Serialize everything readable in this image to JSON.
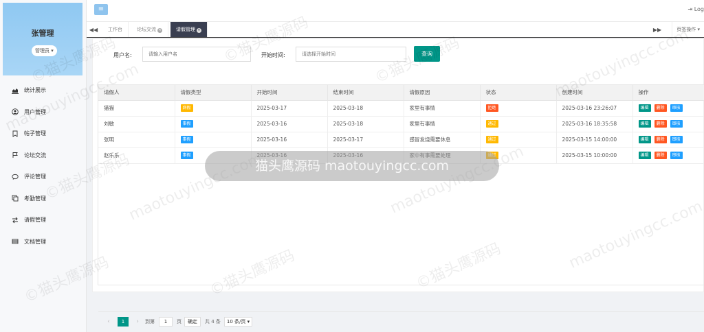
{
  "profile": {
    "name": "张管理",
    "role": "管理员 ▾"
  },
  "nav": [
    {
      "label": "统计展示",
      "icon": "chart-icon"
    },
    {
      "label": "用户管理",
      "icon": "user-icon"
    },
    {
      "label": "帖子管理",
      "icon": "bookmark-icon"
    },
    {
      "label": "论坛交流",
      "icon": "flag-icon"
    },
    {
      "label": "评论管理",
      "icon": "comment-icon"
    },
    {
      "label": "考勤管理",
      "icon": "copy-icon"
    },
    {
      "label": "请假管理",
      "icon": "exchange-icon"
    },
    {
      "label": "文档管理",
      "icon": "list-icon"
    }
  ],
  "topbar": {
    "menu_icon": "≡",
    "logout": "⇥  Log"
  },
  "tabs": {
    "prev": "◀◀",
    "next": "▶▶",
    "items": [
      {
        "label": "工作台"
      },
      {
        "label": "论坛交流"
      },
      {
        "label": "请假管理"
      }
    ],
    "page_ops": "页签操作 ▾"
  },
  "search": {
    "username_label": "用户名:",
    "username_placeholder": "请输入用户名",
    "start_label": "开始时间:",
    "start_placeholder": "请选择开始时间",
    "query_button": "查询"
  },
  "table": {
    "headers": [
      "请假人",
      "请假类型",
      "开始时间",
      "结束时间",
      "请假原因",
      "状态",
      "创建时间",
      "操作"
    ],
    "rows": [
      {
        "name": "猫猫",
        "type": "病假",
        "type_color": "orange",
        "start": "2025-03-17",
        "end": "2025-03-18",
        "reason": "家里有事情",
        "status": "拒绝",
        "status_color": "red",
        "created": "2025-03-16 23:26:07"
      },
      {
        "name": "刘敏",
        "type": "事假",
        "type_color": "blue",
        "start": "2025-03-16",
        "end": "2025-03-18",
        "reason": "家里有事情",
        "status": "通过",
        "status_color": "gold",
        "created": "2025-03-16 18:35:58"
      },
      {
        "name": "张明",
        "type": "事假",
        "type_color": "blue",
        "start": "2025-03-16",
        "end": "2025-03-17",
        "reason": "感冒发烧需要休息",
        "status": "通过",
        "status_color": "gold",
        "created": "2025-03-15 14:00:00"
      },
      {
        "name": "赵乐乐",
        "type": "事假",
        "type_color": "blue",
        "start": "2025-03-16",
        "end": "2025-03-16",
        "reason": "家中有事需要处理",
        "status": "通过",
        "status_color": "gold",
        "created": "2025-03-15 10:00:00"
      }
    ],
    "actions": {
      "edit": "编辑",
      "delete": "删除",
      "audit": "审核"
    }
  },
  "pager": {
    "prev": "‹",
    "current_page": "1",
    "next": "›",
    "goto_label": "到第",
    "goto_value": "1",
    "page_unit": "页",
    "confirm": "确定",
    "total": "共 4 条",
    "page_size": "10 条/页 ▾"
  },
  "watermark": {
    "text_cn": "©猫头鹰源码",
    "text_en": "maotouyingcc.com",
    "banner": "猫头鹰源码 maotouyingcc.com"
  }
}
